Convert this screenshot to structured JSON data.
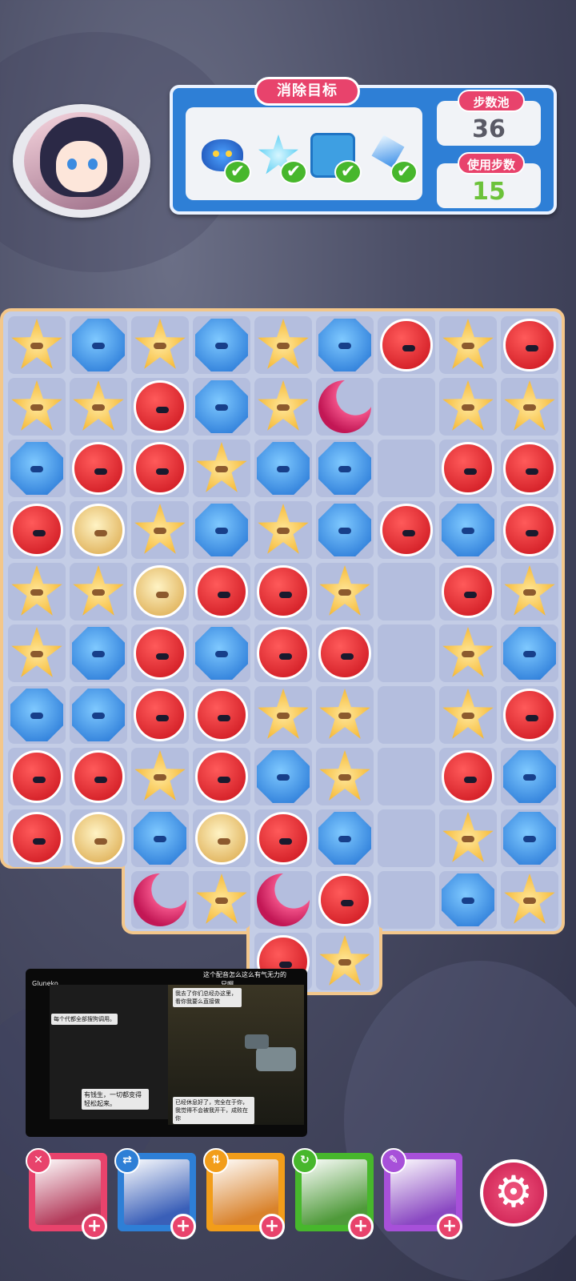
{
  "goals": {
    "title": "消除目标",
    "items": [
      {
        "icon": "spider-monster-icon",
        "done": true
      },
      {
        "icon": "blue-star-gem-icon",
        "done": true
      },
      {
        "icon": "blue-block-icon",
        "done": true
      },
      {
        "icon": "blue-crystal-icon",
        "done": true
      }
    ],
    "check_glyph": "✔"
  },
  "stats": {
    "moves_pool_label": "步数池",
    "moves_pool_value": "36",
    "moves_used_label": "使用步数",
    "moves_used_value": "15"
  },
  "colors": {
    "accent": "#e8436c",
    "panel_blue": "#2e7fd6",
    "moves_pool_value": "#5a5a66",
    "moves_used_value": "#6cc23a"
  },
  "board": {
    "legend": {
      "R": "red-blob-tile",
      "B": "blue-hex-tile",
      "S": "yellow-star-tile",
      "G": "gold-helmet-tile",
      "M": "pink-moon-tile",
      "_": "empty-cell",
      "X": "no-cell"
    },
    "rows": [
      "SBSBSBRSR",
      "SSRBSM_SS",
      "BRRSBB_RR",
      "RGSBSBRBR",
      "SSGRRS_RS",
      "SBRBRR_SB",
      "BBRRSS_SR",
      "RRSRBS_RB",
      "RGBGRB_SB",
      "XXMSMR_BS",
      "XXXXRSXXX"
    ]
  },
  "video": {
    "channel": "Gluneko",
    "caption_top": "这个配音怎么这么有气无力的",
    "caption_top2": "兄啊",
    "bubble_1": "我去了你们总经办这里，看你我要么直接做",
    "bubble_2": "每个代都全部搜狗调用。",
    "bubble_3": "有钱生，一切都变得轻松起来。",
    "bubble_4": "已经休息好了，完全在于你，我觉得不会被我开干，成败在你"
  },
  "heroes": [
    {
      "name": "hero-star-hat",
      "badge": "✕",
      "badge_color": "#e8436c",
      "border": "#e8436c",
      "art": "#b33a5a"
    },
    {
      "name": "hero-white-hair",
      "badge": "⇄",
      "badge_color": "#2e7fd6",
      "border": "#2e7fd6",
      "art": "#3a5fb8"
    },
    {
      "name": "hero-spiky-white",
      "badge": "⇅",
      "badge_color": "#f29d1a",
      "border": "#f29d1a",
      "art": "#d9822b"
    },
    {
      "name": "hero-brown-hair",
      "badge": "↻",
      "badge_color": "#47b72c",
      "border": "#47b72c",
      "art": "#4f9a3a"
    },
    {
      "name": "hero-blonde",
      "badge": "✎",
      "badge_color": "#a750d9",
      "border": "#a750d9",
      "art": "#8a48c2"
    }
  ],
  "hero_plus_glyph": "+",
  "settings_glyph": "⚙"
}
